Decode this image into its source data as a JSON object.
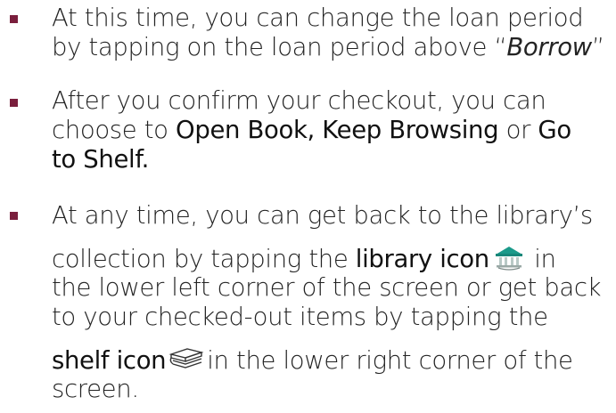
{
  "bullets": [
    {
      "l1": "At this time, you can change the loan period",
      "l2a": "by tapping on the loan period above “",
      "l2b": "Borrow",
      "l2c": "”"
    },
    {
      "l1": "After you confirm your checkout, you can",
      "l2a": "choose to ",
      "l2b": "Open Book, Keep Browsing",
      "l2c": " or ",
      "l2d": "Go",
      "l3": "to Shelf."
    },
    {
      "l1": "At any time, you can get back to the library’s",
      "l2a": "collection by tapping the ",
      "l2b": "library icon",
      "l2c": " in",
      "l3": "the lower left corner of the screen or get back",
      "l4": "to your checked-out items by tapping the",
      "l5a": "shelf icon",
      "l5b": "in the lower right corner of the",
      "l6": "screen."
    }
  ],
  "icons": {
    "library": "library-icon",
    "shelf": "shelf-icon"
  },
  "colors": {
    "bullet": "#7a1f3d",
    "library_icon": "#1a9a8a",
    "text": "#232323"
  }
}
